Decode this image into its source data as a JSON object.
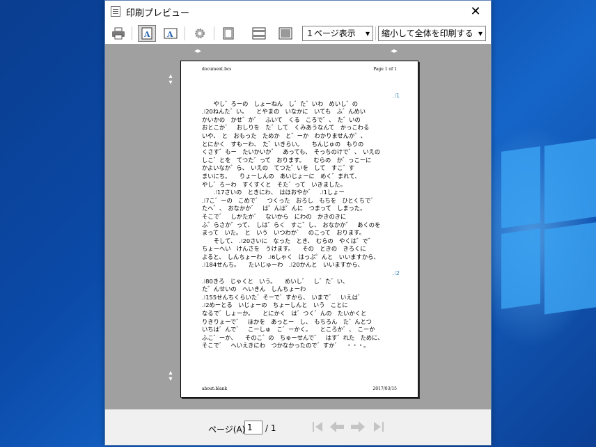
{
  "window": {
    "title": "印刷プレビュー",
    "close_glyph": "✕"
  },
  "toolbar": {
    "print_icon": "printer-icon",
    "portrait_icon": "portrait-icon",
    "landscape_icon": "landscape-icon",
    "settings_icon": "gear-icon",
    "margins_icon": "margins-icon",
    "header_footer_icon": "header-footer-icon",
    "fullpage_icon": "full-page-icon",
    "view_select": "１ページ表示",
    "scale_select": "縮小して全体を印刷する"
  },
  "page": {
    "header_left": "document.bcs",
    "header_right": "Page 1 of 1",
    "footer_left": "about:blank",
    "footer_right": "2017/03/15",
    "lines": [
      "　　　　　　　　　　　　　　　　　　　　　　　　　　　　　　　　　　　　　　　　　　　　　 .⁝1",
      "　　やし゛ろーの　しょーねん　し゛た゛いわ　めいし゛の",
      ".⁝20ねんた゛い。　　とやまの　いなかに　いても　ふ゛んめい",
      "かいかの　かせ゛か゛　ふいて　くる　ころで゛、　た゛いの",
      "おとこか゛　おしりを　た゛して　くみあうなんて　かっこわる",
      "いや、　と　おもった　ためか　と゛ーか　わかりませんか゛、",
      "とにかく　すもーわ、　た゛いきらい。　　ちんじゅの　もりの",
      "くさす゛もー　たいかいか゛　あっても、　そっちのけで゛、　いえの",
      "しこ゛とを　てつた゛って　おります。　　むらの　か゛っこーに",
      "かよいなか゛ら、　いえの　てつた゛いを　して　すこ゛す",
      "まいにち。　　りょーしんの　あいじょーに　めく゛まれて、",
      "やし゛ろーわ　すくすくと　そた゛って　いきました。",
      "　　.⁝17さいの　ときにわ、　はほおやか゛　.⁝1しょー",
      ".⁝7こ゛ーの　こめで゛　つくった　おろし　もちを　ひとくちで゛",
      "たへ゛、　おなかか゛　は゜んは゜んに　つまって　しまった。",
      "そこで゛　しかたか゛　ないから　にわの　かきのきに",
      "ふ゛らさか゛って、　しは゛らく　すこ゛し、　おなかか゛　あくのを",
      "まって　いた。　と　いう　いつわか゛　のこって　おります。",
      "　　そして、　.⁝20さいに　なった　とき、　むらの　やくは゛で゛",
      "ちょーへい　けんさを　うけます。　　その　ときの　きろくに",
      "よると、　しんちょーわ　.⁝6しゃく　はっぷ゜んと　いいますから、",
      ".⁝184せんち。　　たいじゅーわ　.⁝20かんと　いいますから、",
      "　　　　　　　　　　　　　　　　　　　　　　　　　　　　　　　　　　　　　　　　　　　　　 .⁝2",
      ".⁝80きろ　じゃくと　いう。　　めいし゛　し゛た゛い、",
      "た゛んせいの　へいきん　しんちょーわ",
      ".⁝155せんちくらいた゛そーで゛すから、　いまで゛　いえは゛",
      ".⁝2めーとる　いじょーの　ちょーしんと　いう　ことに",
      "なるで゛しょーか。　　とにかく　は゛つく゛んの　たいかくと",
      "りきりょーで゛　ほかを　あっとー　し、　もちろん　た゛んとつ",
      "いちは゛んで゛　こーしゅ　こ゛ーかく。　　ところか゛、　こーか",
      "ふこ゛ーか、　　そのこ゛の　ちゅーせんで゛　はす゛れた　ために、",
      "そこで゛　へいえきにわ　つかなかったので゛すか゛　・・・。"
    ]
  },
  "bottom": {
    "page_label": "ページ(A)",
    "page_value": "1",
    "page_total": "/ 1",
    "first_icon": "first-page-icon",
    "prev_icon": "prev-page-icon",
    "next_icon": "next-page-icon",
    "last_icon": "last-page-icon"
  }
}
